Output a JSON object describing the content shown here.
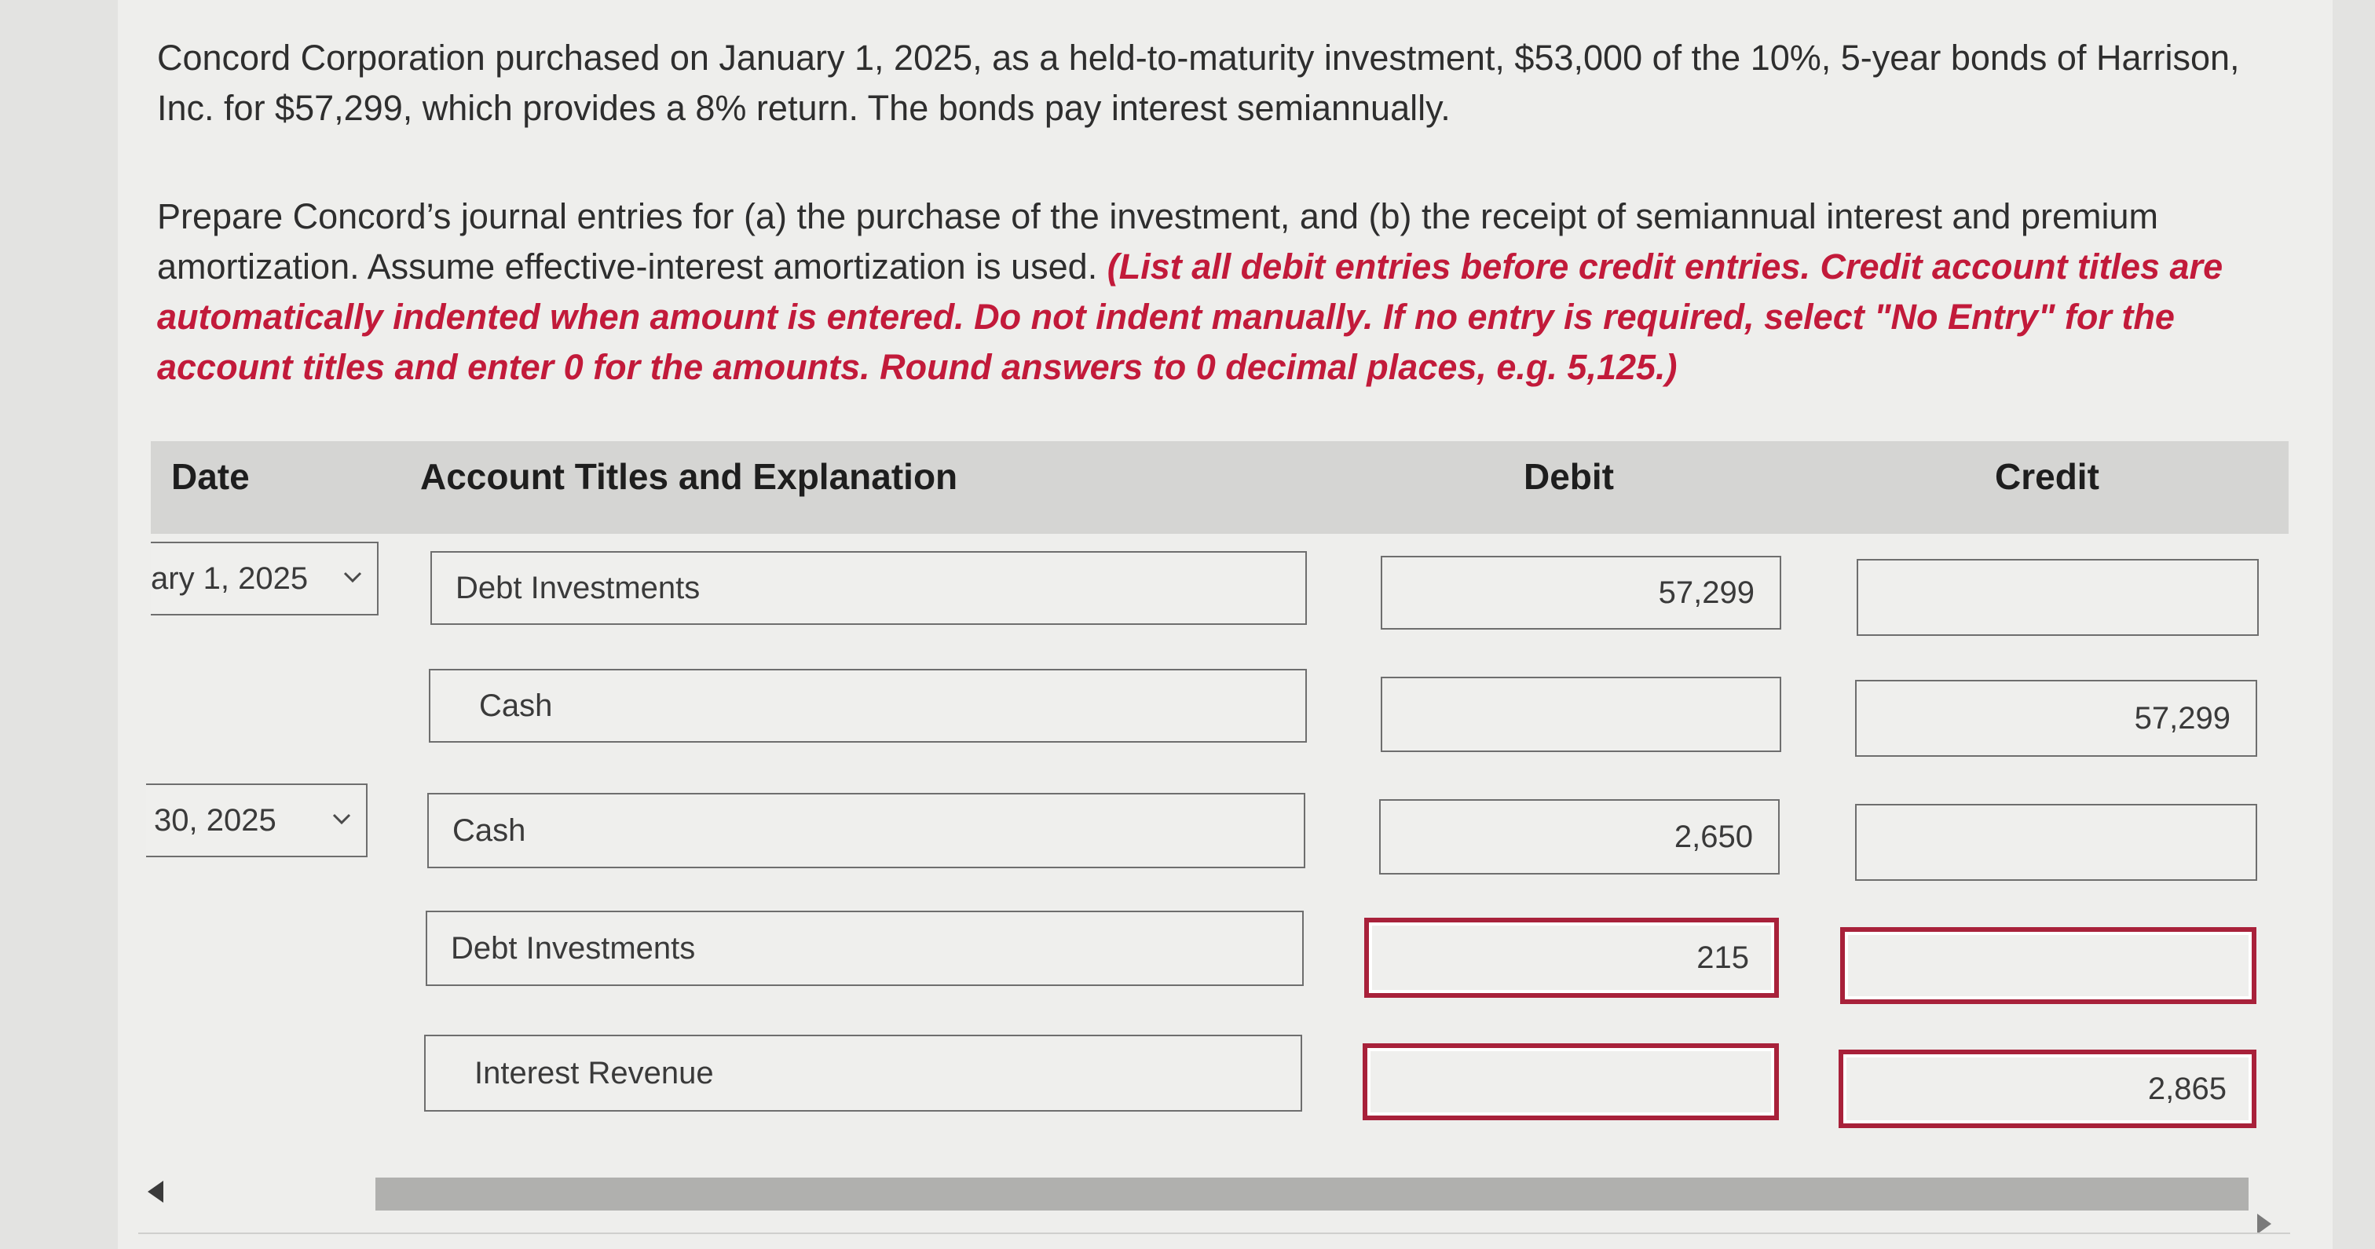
{
  "problem": {
    "intro": "Concord Corporation purchased on January 1, 2025, as a held-to-maturity investment, $53,000 of the 10%, 5-year bonds of Harrison, Inc. for $57,299, which provides a 8% return. The bonds pay interest semiannually.",
    "task": "Prepare Concord’s journal entries for (a) the purchase of the investment, and (b) the receipt of semiannual interest and premium amortization. Assume effective-interest amortization is used. ",
    "instructions": "(List all debit entries before credit entries. Credit account titles are automatically indented when amount is entered. Do not indent manually. If no entry is required, select \"No Entry\" for the account titles and enter 0 for the amounts. Round answers to 0 decimal places, e.g. 5,125.)"
  },
  "table": {
    "headers": {
      "date": "Date",
      "account": "Account Titles and Explanation",
      "debit": "Debit",
      "credit": "Credit"
    },
    "entries": [
      {
        "date": "ary 1, 2025",
        "account": "Debt Investments",
        "debit": "57,299",
        "credit": ""
      },
      {
        "date": "",
        "account": "Cash",
        "debit": "",
        "credit": "57,299"
      },
      {
        "date": "30, 2025",
        "account": "Cash",
        "debit": "2,650",
        "credit": ""
      },
      {
        "date": "",
        "account": "Debt Investments",
        "debit": "215",
        "credit": ""
      },
      {
        "date": "",
        "account": "Interest Revenue",
        "debit": "",
        "credit": "2,865"
      }
    ]
  },
  "colors": {
    "instruction_red": "#c21a3a",
    "error_border": "#a8213a"
  }
}
